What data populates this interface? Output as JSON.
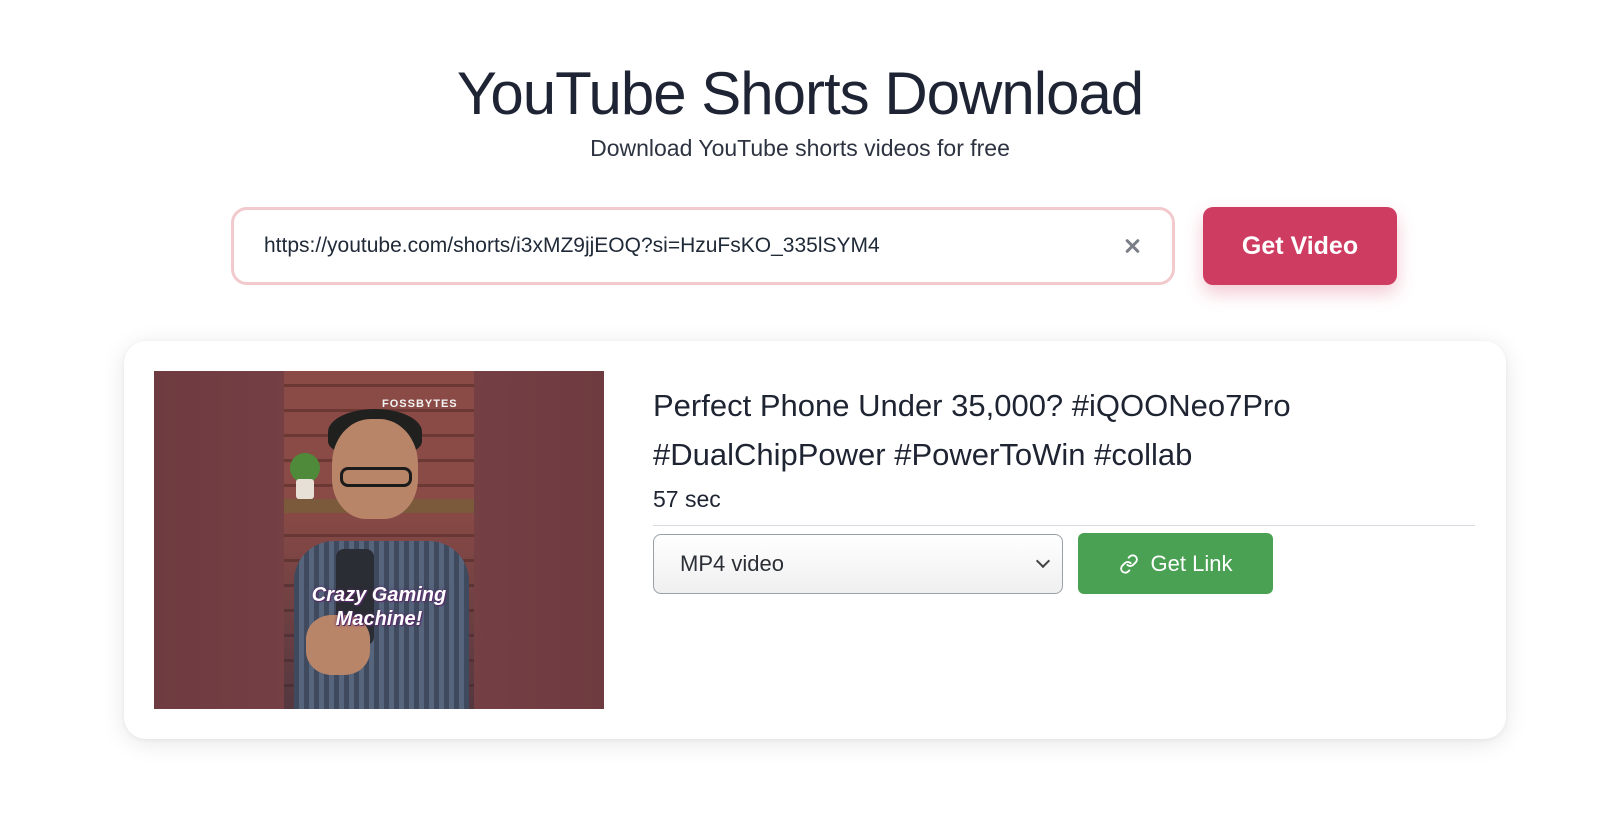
{
  "header": {
    "title": "YouTube Shorts Download",
    "subtitle": "Download YouTube shorts videos for free"
  },
  "search": {
    "value": "https://youtube.com/shorts/i3xMZ9jjEOQ?si=HzuFsKO_335lSYM4",
    "clear_icon": "close-icon",
    "button_label": "Get Video"
  },
  "result": {
    "thumbnail": {
      "brand": "FOSSBYTES",
      "overlay_line1": "Crazy Gaming",
      "overlay_line2": "Machine!"
    },
    "title": "Perfect Phone Under 35,000? #iQOONeo7Pro #DualChipPower #PowerToWin #collab",
    "duration": "57 sec",
    "format_selected": "MP4 video",
    "get_link_label": "Get Link",
    "link_icon": "link-icon"
  },
  "colors": {
    "primary_button": "#cf3c62",
    "success_button": "#4aa154",
    "input_border": "#f2c9cd"
  }
}
